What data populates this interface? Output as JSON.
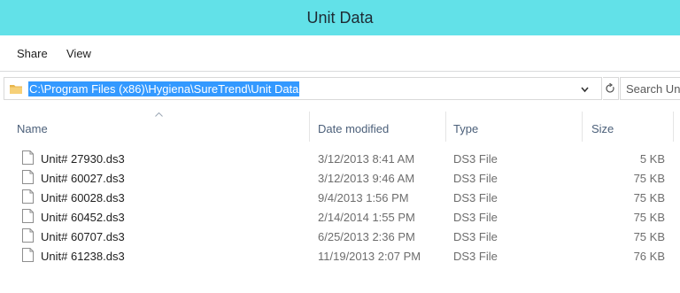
{
  "window": {
    "title": "Unit Data"
  },
  "ribbon": {
    "tabs": [
      {
        "label": "Share"
      },
      {
        "label": "View"
      }
    ]
  },
  "address": {
    "path": "C:\\Program Files (x86)\\Hygiena\\SureTrend\\Unit Data",
    "search_placeholder": "Search Unit Data"
  },
  "columns": {
    "name": "Name",
    "date": "Date modified",
    "type": "Type",
    "size": "Size"
  },
  "files": [
    {
      "name": "Unit# 27930.ds3",
      "date": "3/12/2013 8:41 AM",
      "type": "DS3 File",
      "size": "5 KB"
    },
    {
      "name": "Unit# 60027.ds3",
      "date": "3/12/2013 9:46 AM",
      "type": "DS3 File",
      "size": "75 KB"
    },
    {
      "name": "Unit# 60028.ds3",
      "date": "9/4/2013 1:56 PM",
      "type": "DS3 File",
      "size": "75 KB"
    },
    {
      "name": "Unit# 60452.ds3",
      "date": "2/14/2014 1:55 PM",
      "type": "DS3 File",
      "size": "75 KB"
    },
    {
      "name": "Unit# 60707.ds3",
      "date": "6/25/2013 2:36 PM",
      "type": "DS3 File",
      "size": "75 KB"
    },
    {
      "name": "Unit# 61238.ds3",
      "date": "11/19/2013 2:07 PM",
      "type": "DS3 File",
      "size": "76 KB"
    }
  ],
  "colors": {
    "titlebar": "#62e1e8",
    "selection": "#3399ff",
    "header_text": "#4c607a"
  },
  "icons": {
    "folder": "folder-icon",
    "file": "file-icon",
    "refresh": "refresh-icon",
    "dropdown": "chevron-down-icon",
    "sort": "sort-ascending-icon"
  }
}
